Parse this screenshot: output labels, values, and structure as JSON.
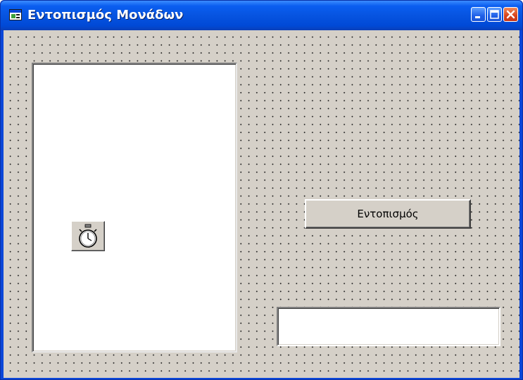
{
  "window": {
    "title": "Εντοπισμός Μονάδων",
    "icon": "form-icon",
    "controls": [
      "minimize-icon",
      "maximize-icon",
      "close-icon"
    ]
  },
  "form": {
    "background_color": "#d5d0c8",
    "listbox": {
      "items": []
    },
    "timer_control": {
      "icon": "stopwatch-icon"
    },
    "button": {
      "label": "Εντοπισμός"
    },
    "textbox": {
      "value": "",
      "placeholder": ""
    }
  },
  "colors": {
    "titlebar": "#0a5ef0",
    "close_button": "#d8431c",
    "form_background": "#d5d0c8"
  }
}
